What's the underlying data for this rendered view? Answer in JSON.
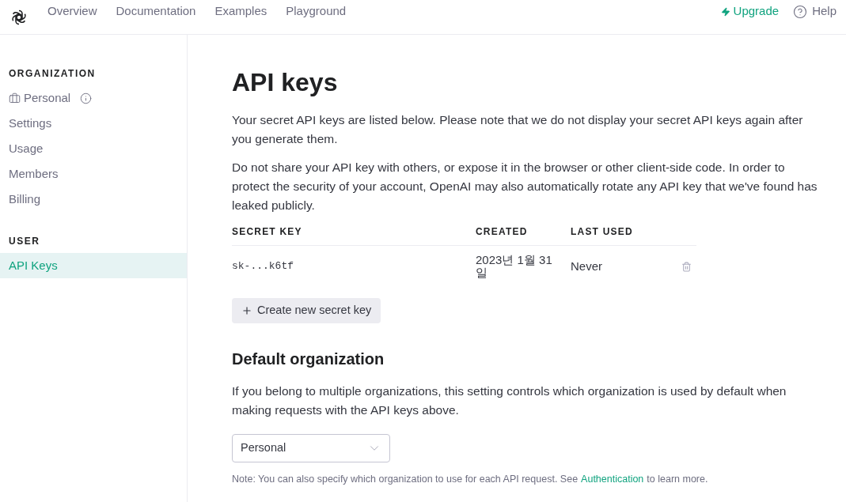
{
  "nav": {
    "links": [
      {
        "label": "Overview"
      },
      {
        "label": "Documentation"
      },
      {
        "label": "Examples"
      },
      {
        "label": "Playground"
      }
    ],
    "upgrade": "Upgrade",
    "help": "Help"
  },
  "sidebar": {
    "sections": [
      {
        "heading": "ORGANIZATION",
        "items": [
          {
            "kind": "org",
            "label": "Personal",
            "selected": false
          },
          {
            "kind": "link",
            "label": "Settings",
            "selected": false
          },
          {
            "kind": "link",
            "label": "Usage",
            "selected": false
          },
          {
            "kind": "link",
            "label": "Members",
            "selected": false
          },
          {
            "kind": "link",
            "label": "Billing",
            "selected": false
          }
        ]
      },
      {
        "heading": "USER",
        "items": [
          {
            "kind": "link",
            "label": "API Keys",
            "selected": true
          }
        ]
      }
    ]
  },
  "page": {
    "title": "API keys",
    "paragraphs": [
      "Your secret API keys are listed below. Please note that we do not display your secret API keys again after you generate them.",
      "Do not share your API key with others, or expose it in the browser or other client-side code. In order to protect the security of your account, OpenAI may also automatically rotate any API key that we've found has leaked publicly."
    ],
    "table": {
      "columns": [
        "SECRET KEY",
        "CREATED",
        "LAST USED"
      ],
      "rows": [
        {
          "key": "sk-...k6tf",
          "created": "2023년 1월 31일",
          "last_used": "Never"
        }
      ]
    },
    "create_button": "Create new secret key",
    "default_org": {
      "title": "Default organization",
      "description": "If you belong to multiple organizations, this setting controls which organization is used by default when making requests with the API keys above.",
      "select": {
        "value": "Personal"
      },
      "note": {
        "before": "Note: You can also specify which organization to use for each API request. See",
        "link": "Authentication",
        "after": "to learn more."
      }
    }
  }
}
